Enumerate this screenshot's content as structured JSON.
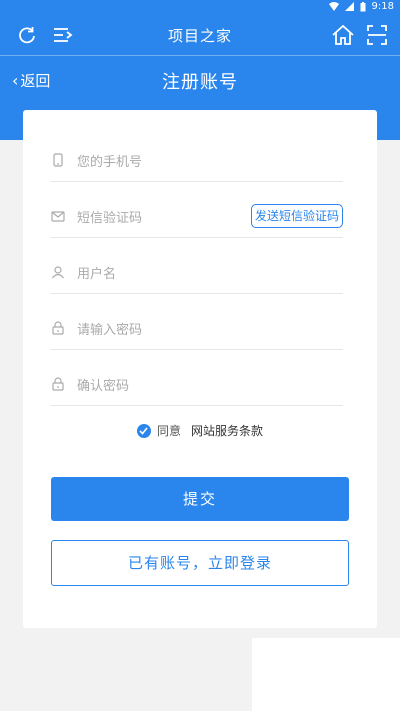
{
  "status": {
    "time": "9:18"
  },
  "app": {
    "title": "项目之家"
  },
  "nav": {
    "back_label": "返回",
    "title": "注册账号"
  },
  "form": {
    "phone_placeholder": "您的手机号",
    "sms_code_placeholder": "短信验证码",
    "send_sms_label": "发送短信验证码",
    "username_placeholder": "用户名",
    "password_placeholder": "请输入密码",
    "confirm_password_placeholder": "确认密码",
    "agree_label": "同意",
    "terms_label": "网站服务条款",
    "agreed": true,
    "submit_label": "提交",
    "login_label": "已有账号，立即登录"
  },
  "colors": {
    "primary": "#2a86ec",
    "background": "#f2f2f2"
  },
  "icons": {
    "refresh": "refresh-icon",
    "menu": "menu-icon",
    "home": "home-icon",
    "scan": "scan-icon"
  }
}
